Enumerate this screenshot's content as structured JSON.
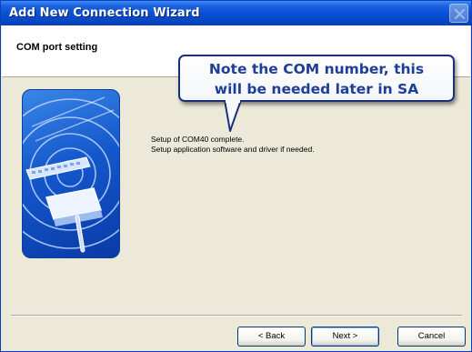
{
  "window": {
    "title": "Add New Connection Wizard"
  },
  "header": {
    "title": "COM port setting"
  },
  "callout": {
    "line1": "Note the COM number, this",
    "line2": "will be needed later in SA"
  },
  "content": {
    "line1": "Setup of COM40 complete.",
    "line2": " Setup application software and driver if needed."
  },
  "buttons": {
    "back": "< Back",
    "next": "Next >",
    "cancel": "Cancel"
  },
  "icons": {
    "close": "close-icon",
    "wizard_art": "wireless-connection-illustration"
  },
  "colors": {
    "titlebar": "#0a50d6",
    "callout_text": "#1f3e96",
    "callout_border": "#1a2f7a",
    "dialog_bg": "#ece9d8"
  }
}
